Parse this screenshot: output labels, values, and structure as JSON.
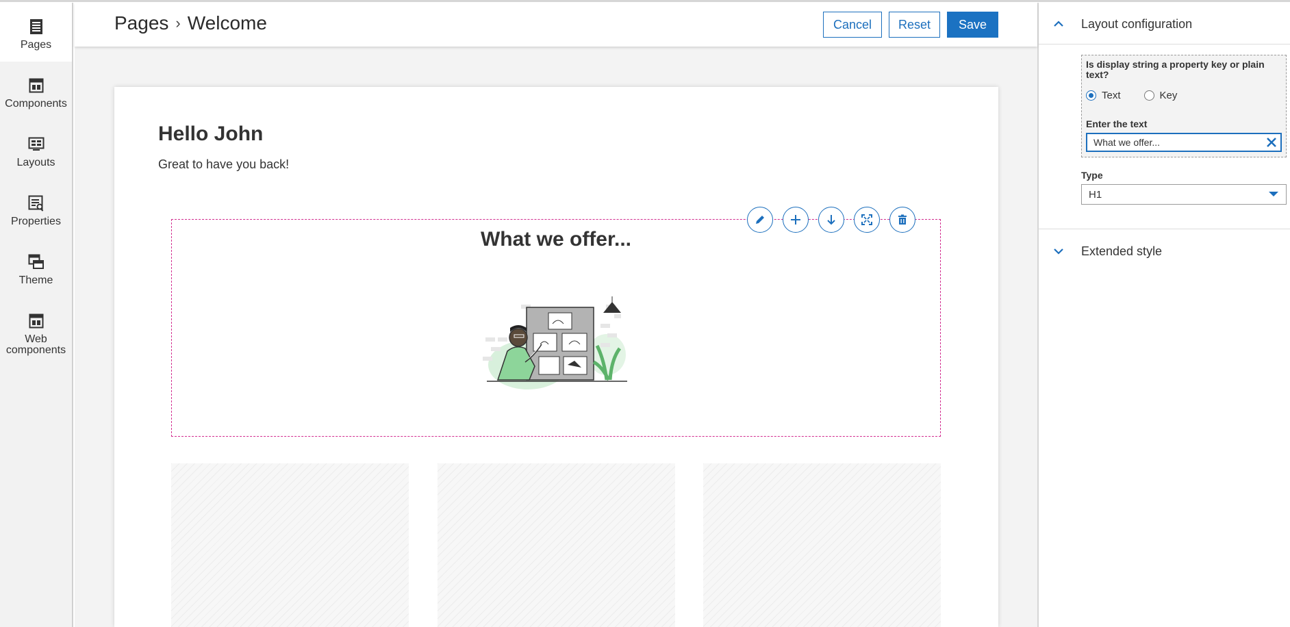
{
  "nav": {
    "items": [
      {
        "label": "Pages",
        "icon": "pages-icon"
      },
      {
        "label": "Components",
        "icon": "components-icon"
      },
      {
        "label": "Layouts",
        "icon": "layouts-icon"
      },
      {
        "label": "Properties",
        "icon": "properties-icon"
      },
      {
        "label": "Theme",
        "icon": "theme-icon"
      },
      {
        "label": "Web components",
        "icon": "web-components-icon"
      }
    ],
    "active": "Pages"
  },
  "header": {
    "breadcrumb": [
      "Pages",
      "Welcome"
    ],
    "buttons": {
      "cancel": "Cancel",
      "reset": "Reset",
      "save": "Save"
    }
  },
  "page": {
    "greeting": "Hello John",
    "subtitle": "Great to have you back!",
    "section": {
      "title": "What we offer...",
      "tools": [
        "edit-icon",
        "add-icon",
        "move-down-icon",
        "expand-icon",
        "delete-icon"
      ]
    }
  },
  "panel": {
    "layout_config": {
      "title": "Layout configuration",
      "question": "Is display string a property key or plain text?",
      "options": [
        "Text",
        "Key"
      ],
      "selected": "Text",
      "enter_label": "Enter the text",
      "text_value": "What we offer...",
      "type_label": "Type",
      "type_value": "H1"
    },
    "extended_style": {
      "title": "Extended style"
    }
  },
  "colors": {
    "accent": "#1b72c2",
    "selection_border": "#d22b8f",
    "rail_bg": "#f2f2f2",
    "canvas_bg": "#f3f3f3"
  }
}
